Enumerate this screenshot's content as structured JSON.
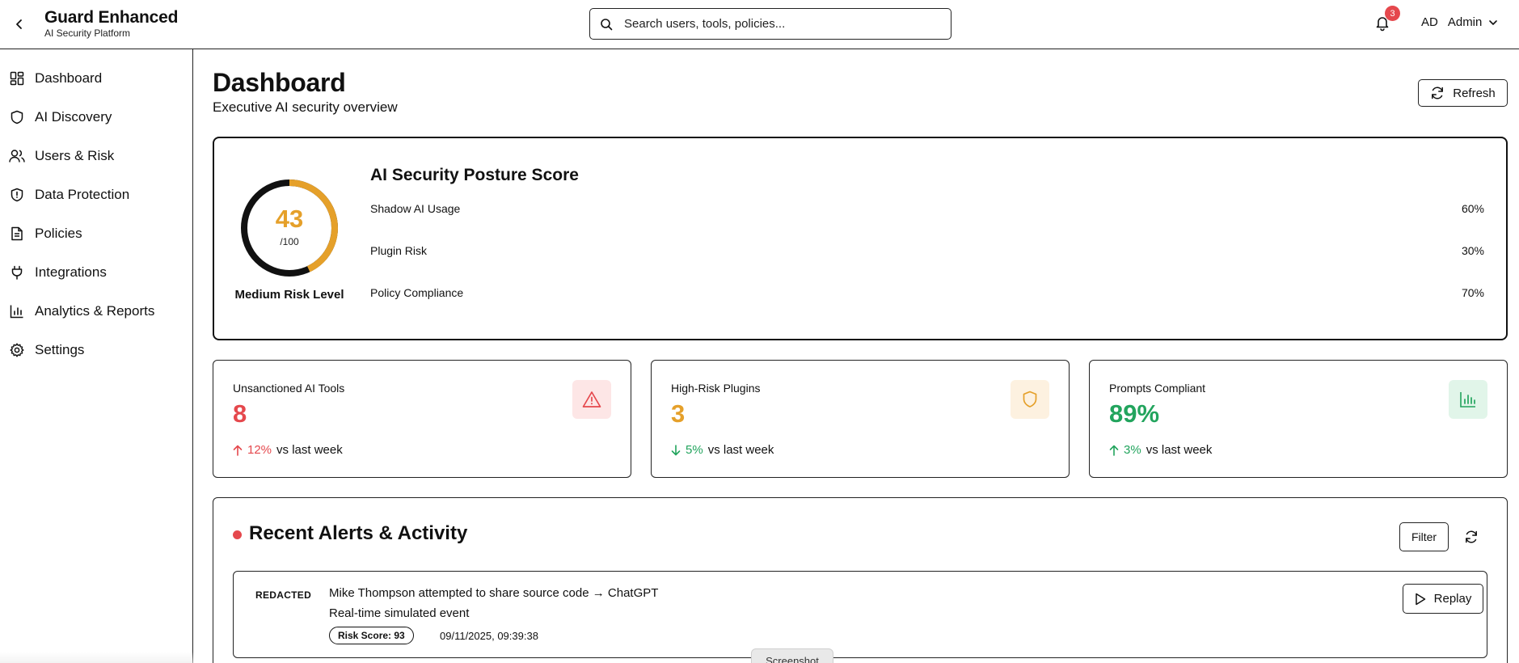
{
  "app": {
    "name": "Guard Enhanced",
    "subtitle": "AI Security Platform"
  },
  "header": {
    "search_placeholder": "Search users, tools, policies...",
    "notification_count": "3",
    "user_initials": "AD",
    "user_name": "Admin"
  },
  "sidebar": {
    "items": [
      {
        "label": "Dashboard",
        "icon": "dashboard-icon"
      },
      {
        "label": "AI Discovery",
        "icon": "shield-icon"
      },
      {
        "label": "Users & Risk",
        "icon": "users-icon"
      },
      {
        "label": "Data Protection",
        "icon": "shield-alert-icon"
      },
      {
        "label": "Policies",
        "icon": "document-icon"
      },
      {
        "label": "Integrations",
        "icon": "plug-icon"
      },
      {
        "label": "Analytics & Reports",
        "icon": "bar-chart-icon"
      },
      {
        "label": "Settings",
        "icon": "gear-icon"
      }
    ]
  },
  "page": {
    "title": "Dashboard",
    "subtitle": "Executive AI security overview",
    "refresh_label": "Refresh"
  },
  "posture": {
    "score": "43",
    "score_max": "/100",
    "score_fraction": 0.43,
    "risk_level": "Medium Risk Level",
    "title": "AI Security Posture Score",
    "metrics": [
      {
        "label": "Shadow AI Usage",
        "value": "60%"
      },
      {
        "label": "Plugin Risk",
        "value": "30%"
      },
      {
        "label": "Policy Compliance",
        "value": "70%"
      }
    ]
  },
  "stats": [
    {
      "label": "Unsanctioned AI Tools",
      "value": "8",
      "trend_value": "12%",
      "trend_suffix": "vs last week",
      "trend_dir": "up",
      "color": "#e5484d",
      "icon": "warning-triangle-icon"
    },
    {
      "label": "High-Risk Plugins",
      "value": "3",
      "trend_value": "5%",
      "trend_suffix": "vs last week",
      "trend_dir": "down",
      "color": "#e5a02a",
      "icon": "shield-icon"
    },
    {
      "label": "Prompts Compliant",
      "value": "89%",
      "trend_value": "3%",
      "trend_suffix": "vs last week",
      "trend_dir": "up",
      "color": "#22a45d",
      "icon": "bar-chart-icon"
    }
  ],
  "alerts": {
    "title": "Recent Alerts & Activity",
    "filter_label": "Filter",
    "items": [
      {
        "tag": "REDACTED",
        "title": "Mike Thompson attempted to share source code → ChatGPT",
        "description": "Real-time simulated event",
        "risk_score": "Risk Score: 93",
        "timestamp": "09/11/2025, 09:39:38",
        "action_label": "Replay"
      }
    ]
  },
  "overlay": {
    "screenshot_label": "Screenshot"
  },
  "colors": {
    "red": "#e5484d",
    "amber": "#e5a02a",
    "green": "#22a45d"
  }
}
